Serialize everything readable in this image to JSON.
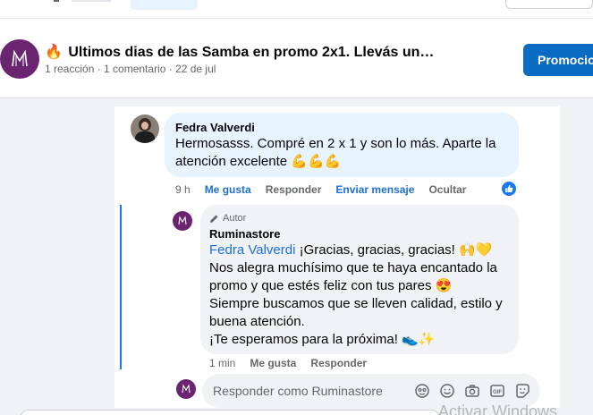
{
  "post": {
    "title_emoji": "🔥",
    "title": "Ultimos dias de las Samba en promo 2x1. Llevás un…",
    "meta": "1 reacción · 1 comentario · 22 de jul",
    "promote_label": "Promocio"
  },
  "comment": {
    "author": "Fedra Valverdi",
    "text_line1": "Hermosasss. Compré en 2 x 1 y son lo más. Aparte la",
    "text_line2": "atención excelente",
    "emojis": "💪💪💪",
    "time": "9 h",
    "like": "Me gusta",
    "reply": "Responder",
    "send_message": "Enviar mensaje",
    "hide": "Ocultar"
  },
  "reply": {
    "badge": "Autor",
    "author": "Ruminastore",
    "mention": "Fedra Valverdi",
    "line1_rest": " ¡Gracias, gracias, gracias! 🙌💛",
    "line2": "Nos alegra muchísimo que te haya encantado la",
    "line3": "promo y que estés feliz con tus pares 😍",
    "line4": "Siempre buscamos que se lleven calidad, estilo y",
    "line5": "buena atención.",
    "line6": "¡Te esperamos para la próxima! 👟✨",
    "time": "1 min",
    "like": "Me gusta",
    "reply": "Responder"
  },
  "composer": {
    "placeholder": "Responder como Ruminastore"
  },
  "watermark": "Activar Windows",
  "colors": {
    "accent": "#1877f2",
    "promote": "#0a6bc2",
    "brand_avatar": "#6b2470",
    "bubble_highlight": "#e7f3ff"
  },
  "icons": [
    "page-logo-icon",
    "like-reaction-icon",
    "pencil-icon",
    "avatar-icon",
    "sticker-icon",
    "emoji-icon",
    "camera-icon",
    "gif-icon",
    "smiley-sticker-icon"
  ]
}
